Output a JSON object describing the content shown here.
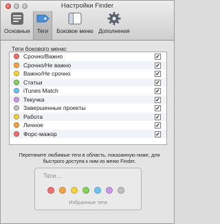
{
  "window": {
    "title": "Настройки Finder"
  },
  "toolbar": [
    {
      "label": "Основные",
      "icon": "general-icon",
      "active": false
    },
    {
      "label": "Теги",
      "icon": "tags-icon",
      "active": true
    },
    {
      "label": "Боковое меню",
      "icon": "sidebar-icon",
      "active": false
    },
    {
      "label": "Дополнения",
      "icon": "advanced-gear-icon",
      "active": false
    }
  ],
  "sidebar_tags": {
    "heading": "Теги бокового меню:",
    "items": [
      {
        "name": "Срочно/Важно",
        "color": "#f26d6d",
        "checked": true
      },
      {
        "name": "Срочно/Не важно",
        "color": "#f5a442",
        "checked": true
      },
      {
        "name": "Важно/Не срочно",
        "color": "#f3d23c",
        "checked": true
      },
      {
        "name": "Статьи",
        "color": "#86d25c",
        "checked": true
      },
      {
        "name": "iTunes Match",
        "color": "#6cc2f0",
        "checked": true
      },
      {
        "name": "Текучка",
        "color": "#c99ae3",
        "checked": true
      },
      {
        "name": "Завершенные проекты",
        "color": "#c0c0c0",
        "checked": true
      },
      {
        "name": "Работа",
        "color": "#f3d23c",
        "checked": true
      },
      {
        "name": "Личное",
        "color": "#f5a442",
        "checked": true
      },
      {
        "name": "Форс-мажор",
        "color": "#f26d6d",
        "checked": true
      }
    ],
    "check_mark": "✓"
  },
  "hint": "Перетяните любимые теги в область, показанную ниже, для быстрого доступа к ним из меню Finder.",
  "favorites": {
    "placeholder": "Теги…",
    "caption": "Избранные теги",
    "colors": [
      "#f26d6d",
      "#f5a442",
      "#f3d23c",
      "#86d25c",
      "#6cc2f0",
      "#c99ae3",
      "#c0c0c0"
    ]
  }
}
